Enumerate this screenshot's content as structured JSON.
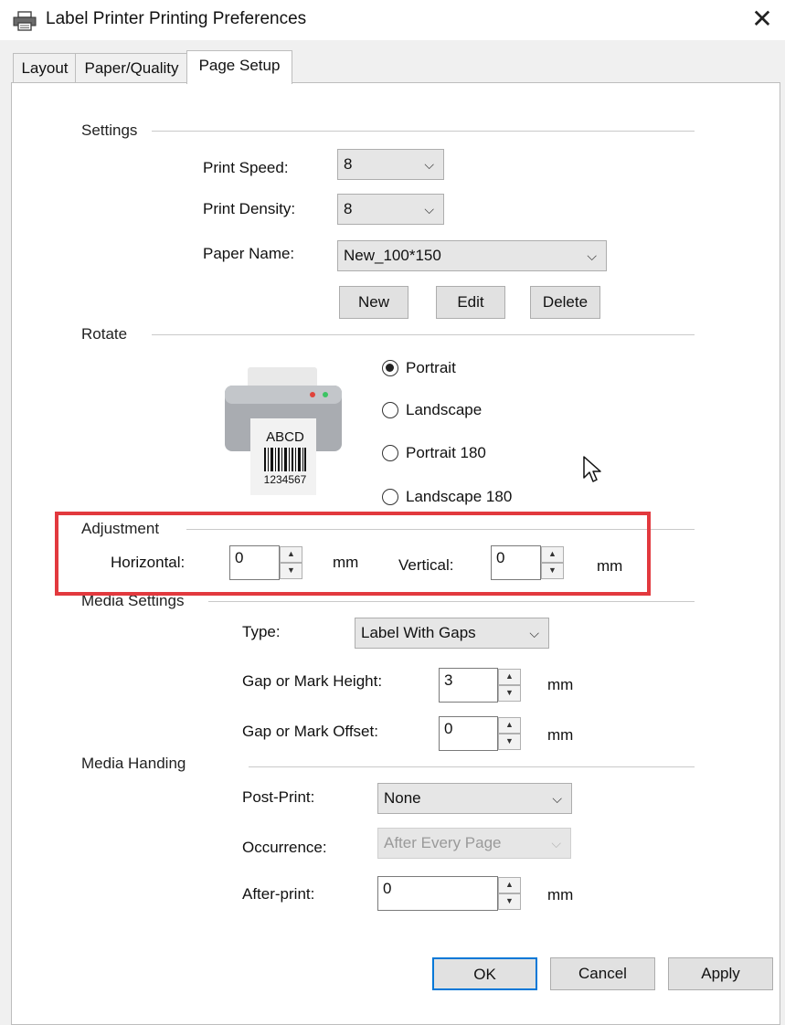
{
  "window": {
    "title": "Label Printer Printing Preferences",
    "close_glyph": "✕"
  },
  "tabs": [
    {
      "label": "Layout"
    },
    {
      "label": "Paper/Quality"
    },
    {
      "label": "Page Setup",
      "active": true
    }
  ],
  "settings": {
    "group_label": "Settings",
    "print_speed": {
      "label": "Print Speed:",
      "value": "8"
    },
    "print_density": {
      "label": "Print Density:",
      "value": "8"
    },
    "paper_name": {
      "label": "Paper Name:",
      "value": "New_100*150"
    },
    "buttons": {
      "new": "New",
      "edit": "Edit",
      "delete": "Delete"
    }
  },
  "rotate": {
    "group_label": "Rotate",
    "preview": {
      "text": "ABCD",
      "number": "1234567"
    },
    "options": [
      {
        "label": "Portrait",
        "selected": true
      },
      {
        "label": "Landscape",
        "selected": false
      },
      {
        "label": "Portrait 180",
        "selected": false
      },
      {
        "label": "Landscape 180",
        "selected": false
      }
    ]
  },
  "adjustment": {
    "group_label": "Adjustment",
    "horizontal": {
      "label": "Horizontal:",
      "value": "0",
      "unit": "mm"
    },
    "vertical": {
      "label": "Vertical:",
      "value": "0",
      "unit": "mm"
    }
  },
  "media_settings": {
    "group_label": "Media Settings",
    "type": {
      "label": "Type:",
      "value": "Label With Gaps"
    },
    "gap_height": {
      "label": "Gap or Mark Height:",
      "value": "3",
      "unit": "mm"
    },
    "gap_offset": {
      "label": "Gap or Mark Offset:",
      "value": "0",
      "unit": "mm"
    }
  },
  "media_handing": {
    "group_label": "Media Handing",
    "post_print": {
      "label": "Post-Print:",
      "value": "None"
    },
    "occurrence": {
      "label": "Occurrence:",
      "value": "After Every Page",
      "disabled": true
    },
    "after_print": {
      "label": "After-print:",
      "value": "0",
      "unit": "mm"
    }
  },
  "footer": {
    "ok": "OK",
    "cancel": "Cancel",
    "apply": "Apply"
  },
  "icons": {
    "chevron": "⌵",
    "spin_up": "▲",
    "spin_down": "▼"
  },
  "colors": {
    "highlight": "#e2393e",
    "led_red": "#e0433b",
    "led_green": "#3cc463"
  }
}
